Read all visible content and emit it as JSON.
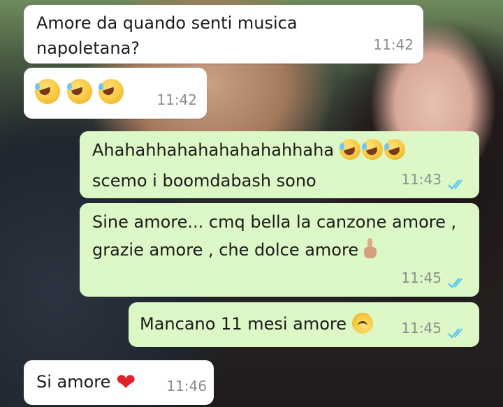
{
  "messages": [
    {
      "direction": "incoming",
      "lines": [
        "Amore da quando senti musica",
        "napoletana?"
      ],
      "time": "11:42"
    },
    {
      "direction": "incoming",
      "emojis": [
        "rolling-on-floor-laughing",
        "rolling-on-floor-laughing",
        "rolling-on-floor-laughing"
      ],
      "time": "11:42"
    },
    {
      "direction": "outgoing",
      "lines": [
        "Ahahahhahahahahahahhaha",
        "scemo i boomdabash sono"
      ],
      "emojis": [
        "rolling-on-floor-laughing",
        "rolling-on-floor-laughing",
        "rolling-on-floor-laughing"
      ],
      "time": "11:43",
      "status": "read"
    },
    {
      "direction": "outgoing",
      "lines": [
        "Sine amore... cmq bella la canzone amore ,",
        "grazie amore , che dolce amore"
      ],
      "emojis": [
        "middle-finger"
      ],
      "time": "11:45",
      "status": "read"
    },
    {
      "direction": "outgoing",
      "lines": [
        "Mancano 11 mesi amore"
      ],
      "emojis": [
        "upside-down-face"
      ],
      "time": "11:45",
      "status": "read"
    },
    {
      "direction": "incoming",
      "lines": [
        "Si amore"
      ],
      "emojis": [
        "red-heart"
      ],
      "time": "11:46"
    }
  ],
  "colors": {
    "incoming_bubble": "#ffffff",
    "outgoing_bubble": "#dcf8c6",
    "read_ticks": "#4fc3f7",
    "timestamp": "#8a8f8c"
  }
}
